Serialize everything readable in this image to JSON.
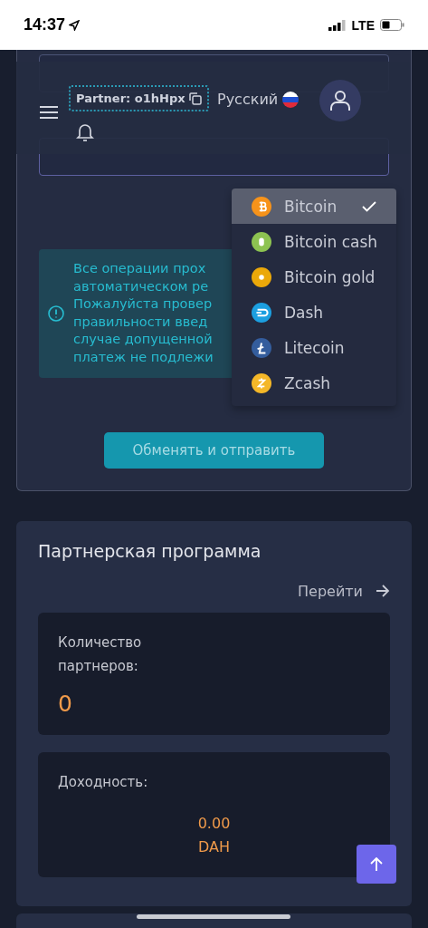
{
  "status_bar": {
    "time": "14:37",
    "network": "LTE"
  },
  "header": {
    "partner": "Partner: o1hHpx",
    "language": "Русский"
  },
  "exchange": {
    "notice_lines": [
      "Все операции прох",
      "автоматическом ре",
      "Пожалуйста провер",
      "правильности введ",
      "случае допущенной",
      "платеж не подлежи"
    ],
    "submit": "Обменять и отправить"
  },
  "currency_menu": [
    {
      "name": "Bitcoin",
      "selected": true,
      "color": "#f7931a"
    },
    {
      "name": "Bitcoin cash",
      "selected": false,
      "color": "#8dc351"
    },
    {
      "name": "Bitcoin gold",
      "selected": false,
      "color": "#eba809"
    },
    {
      "name": "Dash",
      "selected": false,
      "color": "#1c9fe0"
    },
    {
      "name": "Litecoin",
      "selected": false,
      "color": "#345d9d"
    },
    {
      "name": "Zcash",
      "selected": false,
      "color": "#f4b728"
    }
  ],
  "partner_program": {
    "title": "Партнерская программа",
    "link": "Перейти",
    "stats": [
      {
        "label": "Количество партнеров:",
        "value": "0",
        "kind": "large"
      },
      {
        "label": "Доходность:",
        "value": "0.00 DAH",
        "kind": "centered"
      }
    ]
  }
}
